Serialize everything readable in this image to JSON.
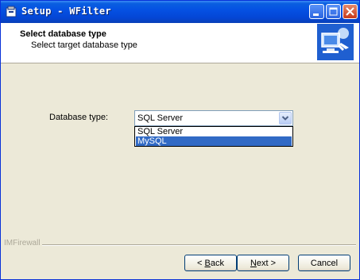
{
  "window": {
    "title": "Setup - WFilter"
  },
  "header": {
    "title": "Select database type",
    "subtitle": "Select target database type"
  },
  "form": {
    "label": "Database type:",
    "selected": "SQL Server",
    "options": [
      "SQL Server",
      "MySQL"
    ]
  },
  "footer": {
    "brand": "IMFirewall"
  },
  "buttons": {
    "back_accel": "B",
    "back_rest": "ack",
    "next_accel": "N",
    "next_rest": "ext >",
    "cancel": "Cancel"
  },
  "colors": {
    "titlebar": "#0551e3",
    "selection": "#316ac5",
    "dialog_bg": "#ece9d8"
  }
}
